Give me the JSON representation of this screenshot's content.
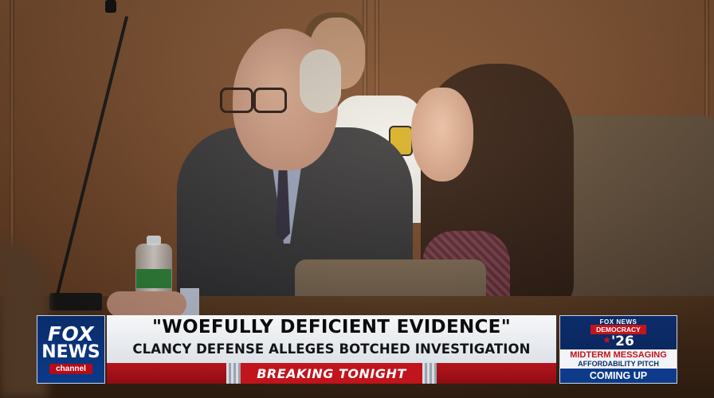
{
  "network": {
    "logo_line1": "FOX",
    "logo_line2": "NEWS",
    "logo_line3": "channel"
  },
  "chyron": {
    "headline": "\"WOEFULLY DEFICIENT EVIDENCE\"",
    "subhead": "CLANCY DEFENSE ALLEGES BOTCHED INVESTIGATION",
    "banner": "BREAKING TONIGHT"
  },
  "promo": {
    "brand": "FOX NEWS",
    "section": "DEMOCRACY",
    "year": "'26",
    "title": "MIDTERM MESSAGING",
    "subtitle": "AFFORDABILITY PITCH",
    "cta": "COMING UP"
  },
  "colors": {
    "fox_blue": "#0a2c6b",
    "breaking_red": "#b6141c",
    "headline_bg": "#f6f7f8"
  }
}
